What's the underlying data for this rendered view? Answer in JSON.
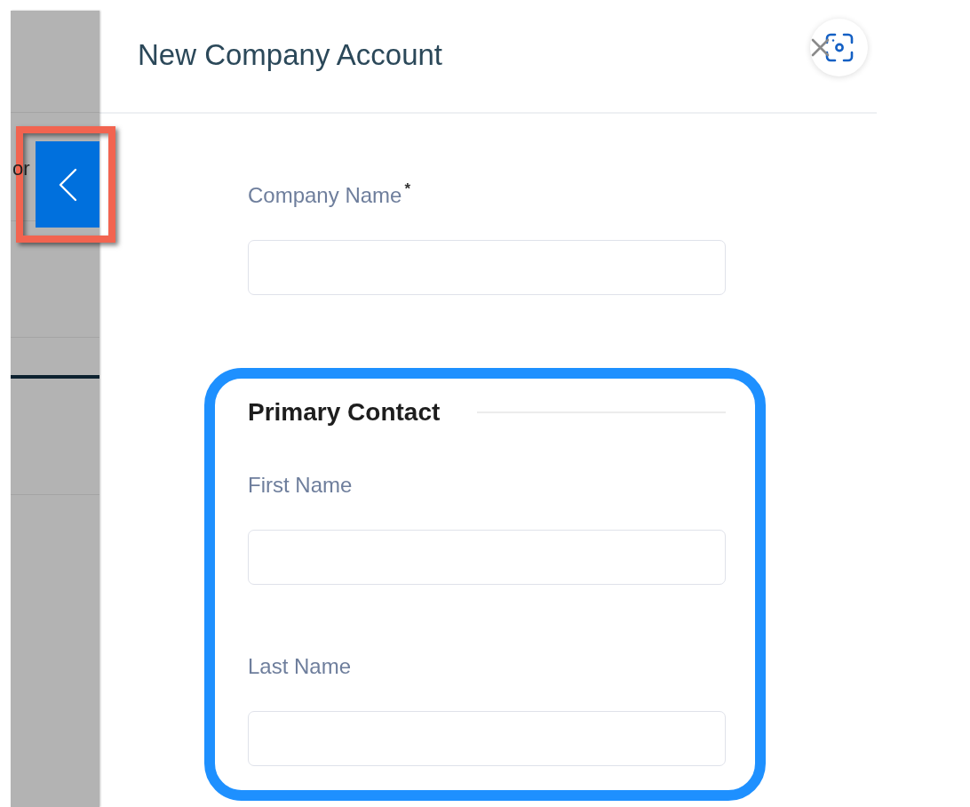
{
  "sidebar": {
    "text": "or",
    "collapse_button": {
      "highlighted": true
    }
  },
  "dialog": {
    "title": "New Company Account"
  },
  "form": {
    "fields": [
      {
        "label": "Company Name$^{*}$"
      }
    ],
    "sections": [
      {
        "title": "Primary Contact",
        "highlighted": true,
        "fields": [
          {
            "label": "First Name"
          },
          {
            "label": "Last Name"
          }
        ]
      }
    ]
  }
}
